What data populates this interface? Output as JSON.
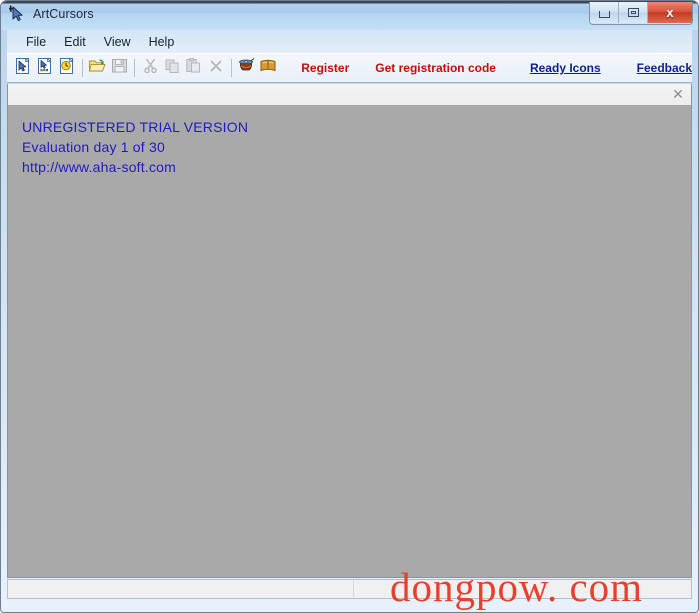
{
  "window": {
    "title": "ArtCursors",
    "icon": "cursor-arrow-icon",
    "controls": {
      "minimize_label": "–",
      "maximize_label": "□",
      "close_label": "x"
    }
  },
  "menu": {
    "items": [
      {
        "label": "File",
        "name": "menu-file"
      },
      {
        "label": "Edit",
        "name": "menu-edit"
      },
      {
        "label": "View",
        "name": "menu-view"
      },
      {
        "label": "Help",
        "name": "menu-help"
      }
    ]
  },
  "toolbar": {
    "buttons": [
      {
        "name": "new-cursor-icon",
        "title": "New Cursor"
      },
      {
        "name": "new-color-cursor-icon",
        "title": "New Color Cursor"
      },
      {
        "name": "new-animated-cursor-icon",
        "title": "New Animated Cursor"
      },
      {
        "name": "open-icon",
        "title": "Open"
      },
      {
        "name": "save-icon",
        "title": "Save"
      },
      {
        "name": "cut-icon",
        "title": "Cut"
      },
      {
        "name": "copy-icon",
        "title": "Copy"
      },
      {
        "name": "paste-icon",
        "title": "Paste"
      },
      {
        "name": "delete-icon",
        "title": "Delete"
      },
      {
        "name": "capture-icon",
        "title": "Capture"
      },
      {
        "name": "help-book-icon",
        "title": "Help"
      }
    ],
    "links": {
      "register": "Register",
      "get_code": "Get registration code",
      "ready_icons": "Ready Icons",
      "feedback": "Feedback"
    }
  },
  "workspace": {
    "mdi_close_label": "✕",
    "trial": {
      "line1": "UNREGISTERED TRIAL VERSION",
      "line2": "Evaluation day 1 of 30",
      "line3": "http://www.aha-soft.com"
    },
    "background_color": "#a9a9a9",
    "trial_text_color": "#2119c4"
  },
  "watermark": {
    "text": "dongpow. com",
    "color": "#e8402f"
  },
  "status_bar": {
    "pane1": "",
    "pane2": ""
  },
  "colors": {
    "register_red": "#c20d0d",
    "link_blue": "#0e1f8c",
    "titlebar_blue": "#b2d1ef"
  }
}
